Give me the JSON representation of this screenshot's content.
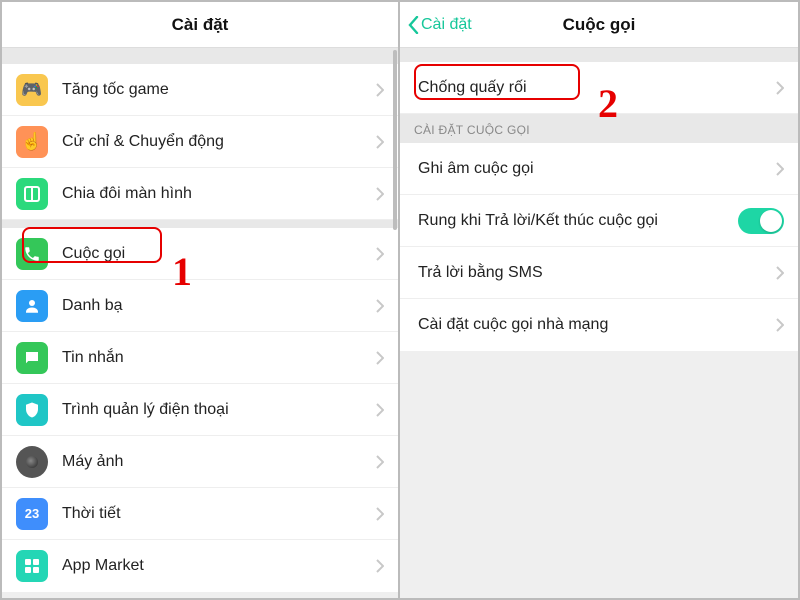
{
  "left": {
    "title": "Cài đặt",
    "items": [
      {
        "label": "Tăng tốc game",
        "icon": "game"
      },
      {
        "label": "Cử chỉ & Chuyển động",
        "icon": "gesture"
      },
      {
        "label": "Chia đôi màn hình",
        "icon": "split"
      },
      {
        "label": "Cuộc gọi",
        "icon": "call"
      },
      {
        "label": "Danh bạ",
        "icon": "contact"
      },
      {
        "label": "Tin nhắn",
        "icon": "msg"
      },
      {
        "label": "Trình quản lý điện thoại",
        "icon": "phmgr"
      },
      {
        "label": "Máy ảnh",
        "icon": "cam"
      },
      {
        "label": "Thời tiết",
        "icon": "weather"
      },
      {
        "label": "App Market",
        "icon": "market"
      }
    ]
  },
  "right": {
    "back": "Cài đặt",
    "title": "Cuộc gọi",
    "top_item": "Chống quấy rối",
    "section": "CÀI ĐẶT CUỘC GỌI",
    "items2": [
      {
        "label": "Ghi âm cuộc gọi",
        "kind": "chevron"
      },
      {
        "label": "Rung khi Trả lời/Kết thúc cuộc gọi",
        "kind": "toggle",
        "on": true
      },
      {
        "label": "Trả lời bằng SMS",
        "kind": "chevron"
      },
      {
        "label": "Cài đặt cuộc gọi nhà mạng",
        "kind": "chevron"
      }
    ]
  },
  "annotations": {
    "n1": "1",
    "n2": "2"
  },
  "weather_value": "23"
}
